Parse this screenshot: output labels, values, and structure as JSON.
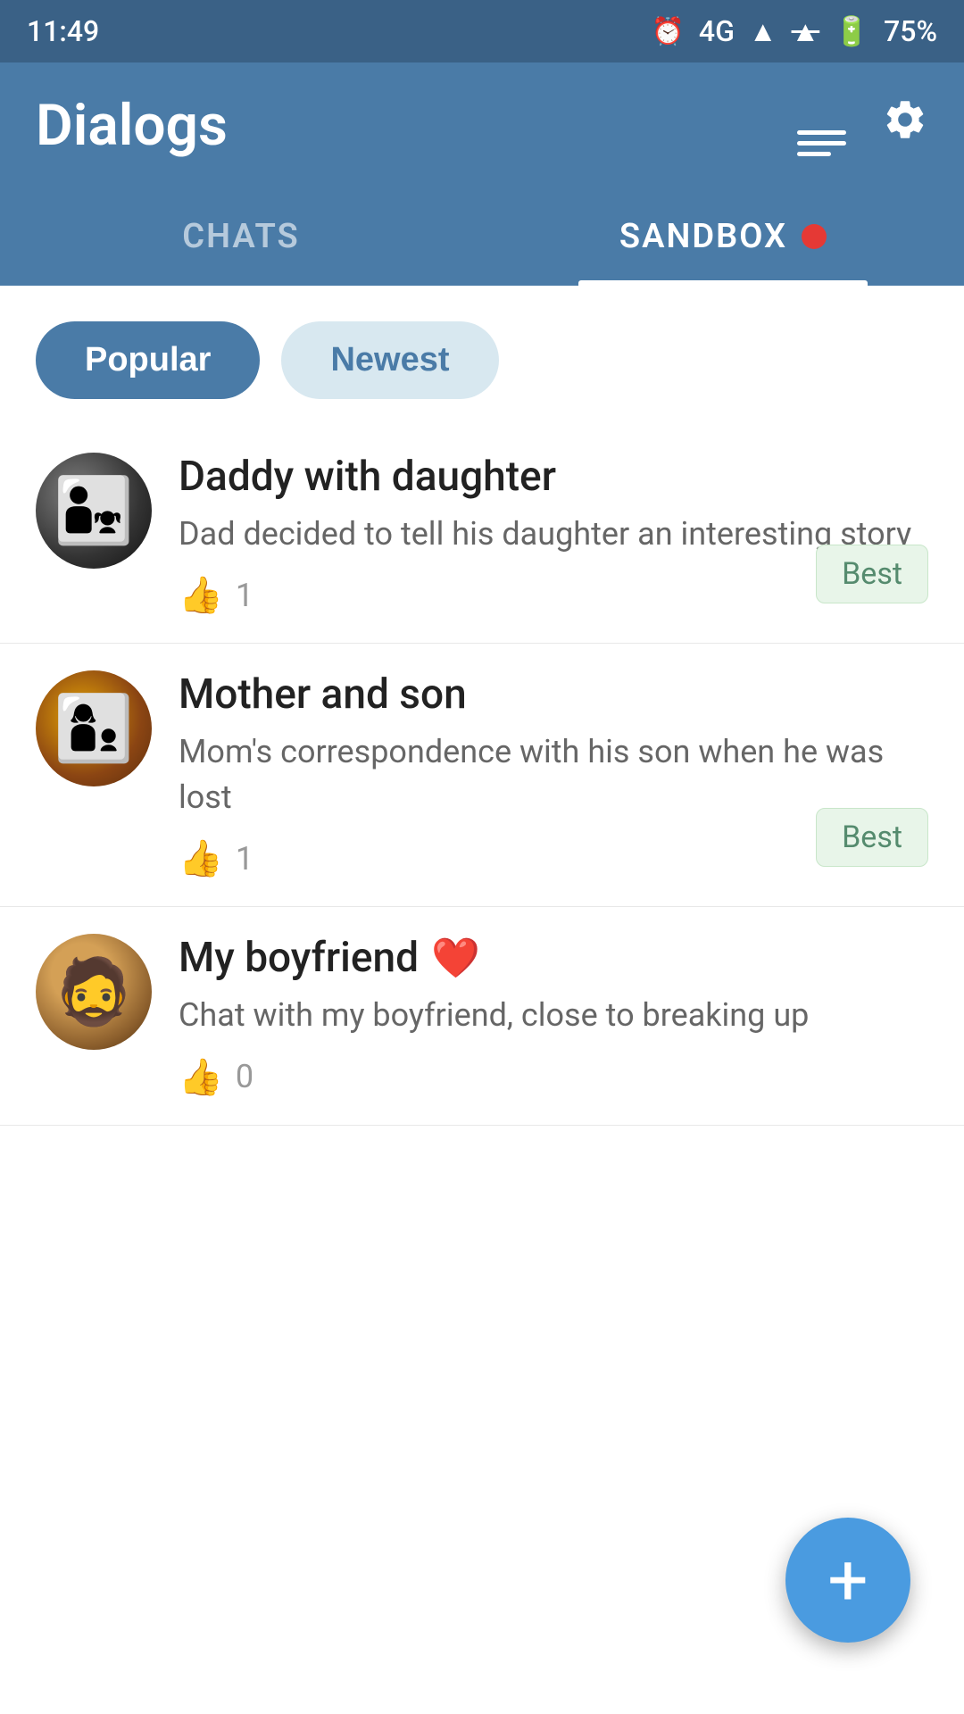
{
  "statusBar": {
    "time": "11:49",
    "signal": "4G",
    "battery": "75%"
  },
  "header": {
    "title": "Dialogs",
    "newChatLabel": "new-chat",
    "settingsLabel": "settings"
  },
  "tabs": [
    {
      "id": "chats",
      "label": "CHATS",
      "active": false
    },
    {
      "id": "sandbox",
      "label": "SANDBOX",
      "active": true,
      "hasNotification": true
    }
  ],
  "filters": [
    {
      "id": "popular",
      "label": "Popular",
      "active": true
    },
    {
      "id": "newest",
      "label": "Newest",
      "active": false
    }
  ],
  "chats": [
    {
      "id": 1,
      "title": "Daddy with daughter",
      "description": "Dad decided to tell his daughter an interesting story",
      "likes": 1,
      "badge": "Best",
      "hasBadge": true,
      "avatarClass": "avatar-1"
    },
    {
      "id": 2,
      "title": "Mother and son",
      "description": "Mom's correspondence with his son when he was lost",
      "likes": 1,
      "badge": "Best",
      "hasBadge": true,
      "avatarClass": "avatar-2"
    },
    {
      "id": 3,
      "title": "My boyfriend",
      "description": "Chat with my boyfriend, close to breaking up",
      "likes": 0,
      "badge": null,
      "hasBadge": false,
      "hasHeart": true,
      "avatarClass": "avatar-3"
    }
  ],
  "fab": {
    "label": "+"
  },
  "colors": {
    "headerBg": "#4a7ba7",
    "activeTab": "#ffffff",
    "inactiveTab": "rgba(255,255,255,0.6)",
    "fabBg": "#4a9be0",
    "badgeBg": "#e8f5e9",
    "badgeText": "#558b6e"
  }
}
